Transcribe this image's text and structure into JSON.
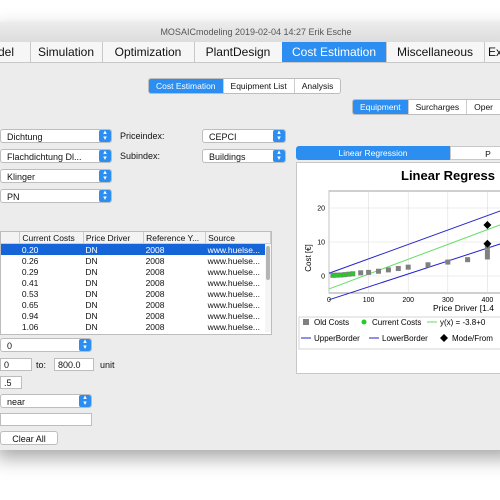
{
  "window": {
    "title": "MOSAICmodeling    2019-02-04   14:27    Erik Esche"
  },
  "menu": {
    "items": [
      {
        "label": "del"
      },
      {
        "label": "Simulation"
      },
      {
        "label": "Optimization"
      },
      {
        "label": "PlantDesign"
      },
      {
        "label": "Cost Estimation"
      },
      {
        "label": "Miscellaneous"
      },
      {
        "label": "Ex"
      }
    ],
    "active_index": 4
  },
  "top_tabs": [
    "Cost Estimation",
    "Equipment List",
    "Analysis"
  ],
  "sub_tabs": [
    "Equipment",
    "Surcharges",
    "Oper"
  ],
  "form": {
    "component_select": "Dichtung",
    "type_select": "Flachdichtung Dl...",
    "manufacturer_select": "Klinger",
    "param_select": "PN",
    "priceindex_label": "Priceindex:",
    "priceindex_value": "CEPCI",
    "subindex_label": "Subindex:",
    "subindex_value": "Buildings"
  },
  "table": {
    "columns": [
      "",
      "Current Costs",
      "Price Driver",
      "Reference Y...",
      "Source"
    ],
    "rows": [
      [
        "",
        "0.20",
        "DN",
        "2008",
        "www.huelse..."
      ],
      [
        "",
        "0.26",
        "DN",
        "2008",
        "www.huelse..."
      ],
      [
        "",
        "0.29",
        "DN",
        "2008",
        "www.huelse..."
      ],
      [
        "",
        "0.41",
        "DN",
        "2008",
        "www.huelse..."
      ],
      [
        "",
        "0.53",
        "DN",
        "2008",
        "www.huelse..."
      ],
      [
        "",
        "0.65",
        "DN",
        "2008",
        "www.huelse..."
      ],
      [
        "",
        "0.94",
        "DN",
        "2008",
        "www.huelse..."
      ],
      [
        "",
        "1.06",
        "DN",
        "2008",
        "www.huelse..."
      ]
    ],
    "selected_row": 0
  },
  "range": {
    "select_value": "0",
    "from_value": "0",
    "to_label": "to:",
    "to_value": "800.0",
    "unit_label": "unit",
    "step_value": ".5",
    "regression_select": "near",
    "extra_value": "",
    "clear_button": "Clear All"
  },
  "chart_tabs": [
    "Linear Regression",
    "P"
  ],
  "chart_data": {
    "type": "scatter",
    "title": "Linear Regress",
    "xlabel": "Price Driver [1.4",
    "ylabel": "Cost [€]",
    "xlim": [
      0,
      500
    ],
    "ylim": [
      -5,
      25
    ],
    "xticks": [
      0,
      100,
      200,
      300,
      400
    ],
    "yticks": [
      0,
      10,
      20
    ],
    "grid": true,
    "series": [
      {
        "name": "Old Costs",
        "color": "#808080",
        "x": [
          10,
          20,
          30,
          40,
          50,
          60,
          80,
          100,
          125,
          150,
          175,
          200,
          250,
          300,
          350,
          400,
          400,
          400
        ],
        "y": [
          0.2,
          0.26,
          0.29,
          0.41,
          0.53,
          0.65,
          0.94,
          1.06,
          1.4,
          1.8,
          2.2,
          2.6,
          3.3,
          4.1,
          4.8,
          5.6,
          7,
          8.5
        ]
      },
      {
        "name": "Current Costs",
        "color": "#22cc22",
        "x": [
          10,
          20,
          30,
          40,
          50,
          60
        ],
        "y": [
          0.2,
          0.26,
          0.29,
          0.41,
          0.53,
          0.65
        ]
      },
      {
        "name": "Mode/From",
        "color": "#000000",
        "x": [
          400,
          400
        ],
        "y": [
          15,
          9.5
        ]
      }
    ],
    "lines": [
      {
        "name": "y(x) = -3.8+0",
        "color": "#66dd66",
        "x": [
          0,
          500
        ],
        "y": [
          -3.8,
          18
        ]
      },
      {
        "name": "UpperBorder",
        "color": "#2222cc",
        "x": [
          0,
          500
        ],
        "y": [
          0.8,
          22
        ]
      },
      {
        "name": "LowerBorder",
        "color": "#2222cc",
        "x": [
          0,
          500
        ],
        "y": [
          -7,
          12
        ]
      }
    ],
    "legend": [
      "Old Costs",
      "Current Costs",
      "y(x) = -3.8+0",
      "UpperBorder",
      "LowerBorder",
      "Mode/From"
    ]
  }
}
